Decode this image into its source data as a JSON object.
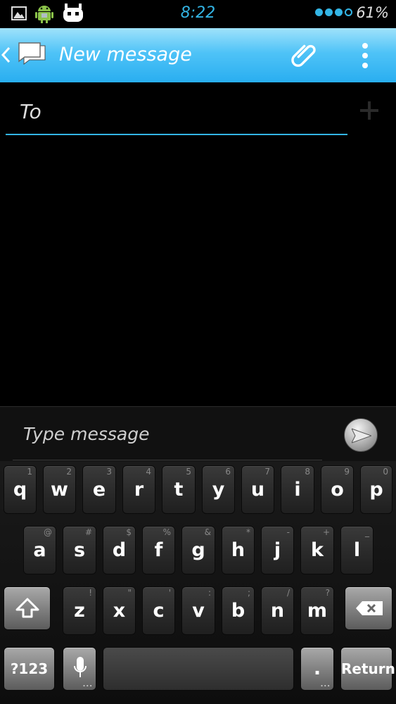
{
  "status_bar": {
    "time": "8:22",
    "battery": "61%",
    "icons": [
      "image-icon",
      "android-icon",
      "cyanogenmod-icon"
    ],
    "signal_dots_filled": 3,
    "signal_dots_total": 4,
    "accent_color": "#33b5e5"
  },
  "action_bar": {
    "title": "New message",
    "icons": [
      "back-icon",
      "messaging-app-icon",
      "attach-icon",
      "overflow-menu-icon"
    ],
    "gradient_colors": [
      "#9fe2fb",
      "#29aef0"
    ]
  },
  "recipients": {
    "placeholder": "To"
  },
  "compose": {
    "placeholder": "Type message",
    "send_icon": "send-icon"
  },
  "keyboard": {
    "row1": [
      {
        "key": "q",
        "sub": "1"
      },
      {
        "key": "w",
        "sub": "2"
      },
      {
        "key": "e",
        "sub": "3"
      },
      {
        "key": "r",
        "sub": "4"
      },
      {
        "key": "t",
        "sub": "5"
      },
      {
        "key": "y",
        "sub": "6"
      },
      {
        "key": "u",
        "sub": "7"
      },
      {
        "key": "i",
        "sub": "8"
      },
      {
        "key": "o",
        "sub": "9"
      },
      {
        "key": "p",
        "sub": "0"
      }
    ],
    "row2": [
      {
        "key": "a",
        "sub": "@"
      },
      {
        "key": "s",
        "sub": "#"
      },
      {
        "key": "d",
        "sub": "$"
      },
      {
        "key": "f",
        "sub": "%"
      },
      {
        "key": "g",
        "sub": "&"
      },
      {
        "key": "h",
        "sub": "*"
      },
      {
        "key": "j",
        "sub": "-"
      },
      {
        "key": "k",
        "sub": "+"
      },
      {
        "key": "l",
        "sub": "_"
      }
    ],
    "row3": [
      {
        "key": "z",
        "sub": "!"
      },
      {
        "key": "x",
        "sub": "\""
      },
      {
        "key": "c",
        "sub": "'"
      },
      {
        "key": "v",
        "sub": ":"
      },
      {
        "key": "b",
        "sub": ";"
      },
      {
        "key": "n",
        "sub": "/"
      },
      {
        "key": "m",
        "sub": "?"
      }
    ],
    "symbols_label": "?123",
    "period_label": ".",
    "return_label": "Return",
    "special_icons": [
      "shift-icon",
      "backspace-icon",
      "microphone-icon"
    ]
  }
}
